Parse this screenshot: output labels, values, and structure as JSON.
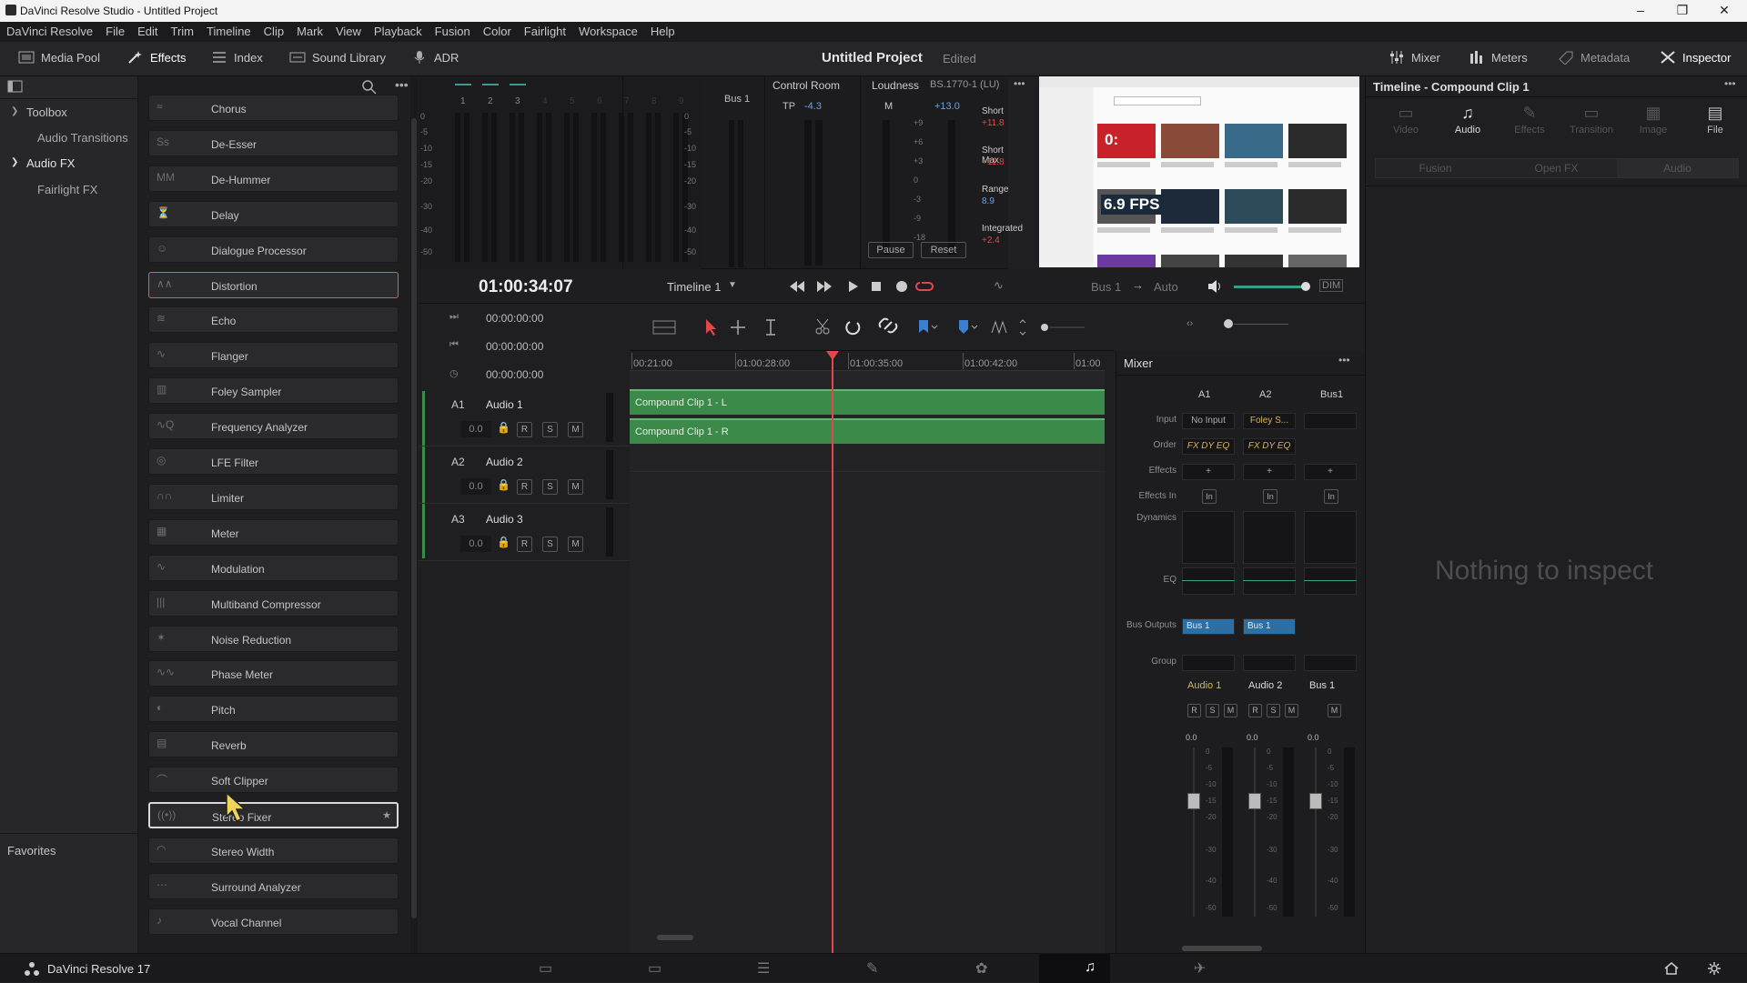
{
  "window": {
    "title": "DaVinci Resolve Studio - Untitled Project"
  },
  "menu": [
    "DaVinci Resolve",
    "File",
    "Edit",
    "Trim",
    "Timeline",
    "Clip",
    "Mark",
    "View",
    "Playback",
    "Fusion",
    "Color",
    "Fairlight",
    "Workspace",
    "Help"
  ],
  "toolbar": {
    "media_pool": "Media Pool",
    "effects": "Effects",
    "index": "Index",
    "sound_library": "Sound Library",
    "adr": "ADR",
    "project": "Untitled Project",
    "edited": "Edited",
    "mixer": "Mixer",
    "meters": "Meters",
    "metadata": "Metadata",
    "inspector": "Inspector"
  },
  "toolbox": {
    "toolbox": "Toolbox",
    "audio_transitions": "Audio Transitions",
    "audio_fx": "Audio FX",
    "fairlight_fx": "Fairlight FX",
    "favorites": "Favorites"
  },
  "effects": [
    "Chorus",
    "De-Esser",
    "De-Hummer",
    "Delay",
    "Dialogue Processor",
    "Distortion",
    "Echo",
    "Flanger",
    "Foley Sampler",
    "Frequency Analyzer",
    "LFE Filter",
    "Limiter",
    "Meter",
    "Modulation",
    "Multiband Compressor",
    "Noise Reduction",
    "Phase Meter",
    "Pitch",
    "Reverb",
    "Soft Clipper",
    "Stereo Fixer",
    "Stereo Width",
    "Surround Analyzer",
    "Vocal Channel"
  ],
  "meters": {
    "ch": [
      "1",
      "2",
      "3",
      "4",
      "5",
      "6",
      "7",
      "8",
      "9"
    ],
    "scale": [
      "0",
      "-5",
      "-10",
      "-15",
      "-20",
      "-30",
      "-40",
      "-50"
    ],
    "bus": "Bus 1",
    "control_room": "Control Room",
    "tp": "TP",
    "tp_value": "-4.3",
    "loudness": "Loudness",
    "standard": "BS.1770-1 (LU)",
    "m": "M",
    "m_value": "+13.0",
    "short": "Short",
    "short_value": "+11.8",
    "short_max": "Short Max",
    "short_max_value": "+11.8",
    "range": "Range",
    "range_value": "8.9",
    "integrated": "Integrated",
    "integrated_value": "+2.4",
    "pause": "Pause",
    "reset": "Reset",
    "m_scale": [
      "+9",
      "+6",
      "+3",
      "0",
      "-3",
      "-9",
      "-18"
    ]
  },
  "viewer": {
    "badge": "6.9 FPS",
    "badge2": "0:"
  },
  "inspector": {
    "title": "Timeline - Compound Clip 1",
    "tabs": [
      "Video",
      "Audio",
      "Effects",
      "Transition",
      "Image",
      "File"
    ],
    "subtabs": [
      "Fusion",
      "Open FX",
      "Audio"
    ],
    "empty": "Nothing to inspect"
  },
  "transport": {
    "timecode": "01:00:34:07",
    "timeline": "Timeline 1",
    "bus": "Bus 1",
    "auto": "Auto",
    "dim": "DIM"
  },
  "tracks": {
    "tc": [
      "00:00:00:00",
      "00:00:00:00",
      "00:00:00:00"
    ],
    "list": [
      {
        "id": "A1",
        "name": "Audio 1",
        "vol": "0.0"
      },
      {
        "id": "A2",
        "name": "Audio 2",
        "vol": "0.0"
      },
      {
        "id": "A3",
        "name": "Audio 3",
        "vol": "0.0"
      }
    ],
    "r": "R",
    "s": "S",
    "m": "M"
  },
  "ruler": [
    "00:21:00",
    "01:00:28:00",
    "01:00:35:00",
    "01:00:42:00",
    "01:00"
  ],
  "clips": {
    "l": "Compound Clip 1 - L",
    "r": "Compound Clip 1 - R"
  },
  "mixer": {
    "title": "Mixer",
    "cols": [
      "A1",
      "A2",
      "Bus1"
    ],
    "rows": {
      "input": "Input",
      "order": "Order",
      "effects": "Effects",
      "effects_in": "Effects In",
      "dynamics": "Dynamics",
      "eq": "EQ",
      "bus_outputs": "Bus Outputs",
      "group": "Group"
    },
    "input": [
      "No Input",
      "Foley S..."
    ],
    "order": "FX DY EQ",
    "bus_out": "Bus 1",
    "names": [
      "Audio 1",
      "Audio 2",
      "Bus 1"
    ],
    "vol": "0.0",
    "plus": "+",
    "in": "In",
    "scale": [
      "0",
      "-5",
      "-10",
      "-15",
      "-20",
      "-30",
      "-40",
      "-50"
    ]
  },
  "bottom": {
    "app": "DaVinci Resolve 17"
  },
  "colors": {
    "accent": "#e0484a",
    "clip": "#3c8a4a",
    "highlight": "#e05a5a",
    "blue": "#3a7fd0"
  }
}
